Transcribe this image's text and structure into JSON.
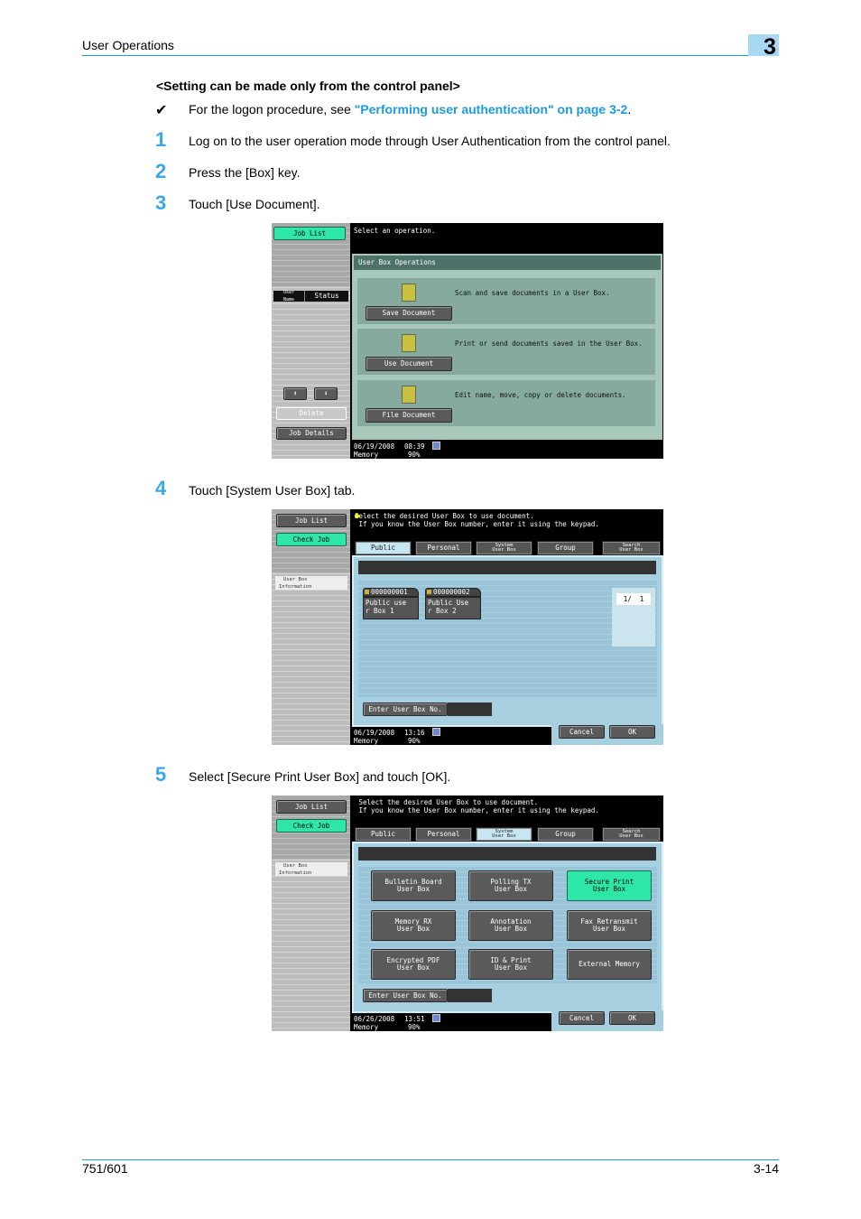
{
  "header": {
    "section": "User Operations",
    "chapter": "3"
  },
  "subheading": "<Setting can be made only from the control panel>",
  "note": {
    "icon": "checkmark-icon",
    "glyph": "✔",
    "prefix": "For the logon procedure, see ",
    "link": "\"Performing user authentication\" on page 3-2",
    "suffix": "."
  },
  "steps": [
    {
      "num": "1",
      "text": "Log on to the user operation mode through User Authentication from the control panel."
    },
    {
      "num": "2",
      "text": "Press the [Box] key."
    },
    {
      "num": "3",
      "text": "Touch [Use Document]."
    },
    {
      "num": "4",
      "text": "Touch [System User Box] tab."
    },
    {
      "num": "5",
      "text": "Select [Secure Print User Box] and touch [OK]."
    }
  ],
  "screen1": {
    "job_list": "Job List",
    "message": "Select an operation.",
    "panel_title": "User Box Operations",
    "col_user": "User\nName",
    "col_status": "Status",
    "up": "⬆",
    "down": "⬇",
    "delete": "Delete",
    "job_details": "Job Details",
    "ops": [
      {
        "button": "Save Document",
        "desc": "Scan and save documents in a User Box.",
        "icon": "save-document-icon"
      },
      {
        "button": "Use Document",
        "desc": "Print or send documents saved in the User Box.",
        "icon": "use-document-icon"
      },
      {
        "button": "File Document",
        "desc": "Edit name, move, copy or delete documents.",
        "icon": "file-document-icon"
      }
    ],
    "date": "06/19/2008",
    "time": "08:39",
    "memory_label": "Memory",
    "memory": "90%"
  },
  "screen2": {
    "job_list": "Job List",
    "check_job": "Check Job",
    "info": "User Box\nInformation",
    "message": "Select the desired User Box to use document.\n If you know the User Box number, enter it using the keypad.",
    "tabs": [
      "Public",
      "Personal",
      "System\nUser Box",
      "Group",
      "Search\nUser Box"
    ],
    "active_tab": 0,
    "boxes": [
      {
        "number": "000000001",
        "name": "Public use\nr Box 1"
      },
      {
        "number": "000000002",
        "name": "Public Use\nr Box 2"
      }
    ],
    "page": "1/  1",
    "enter_no": "Enter User Box No.",
    "cancel": "Cancel",
    "ok": "OK",
    "date": "06/19/2008",
    "time": "13:16",
    "memory_label": "Memory",
    "memory": "90%"
  },
  "screen3": {
    "job_list": "Job List",
    "check_job": "Check Job",
    "info": "User Box\nInformation",
    "message": " Select the desired User Box to use document.\n If you know the User Box number, enter it using the keypad.",
    "tabs": [
      "Public",
      "Personal",
      "System\nUser Box",
      "Group",
      "Search\nUser Box"
    ],
    "active_tab": 2,
    "buttons": [
      "Bulletin Board\nUser Box",
      "Polling TX\nUser Box",
      "Secure Print\nUser Box",
      "Memory RX\nUser Box",
      "Annotation\nUser Box",
      "Fax Retransmit\nUser Box",
      "Encrypted PDF\nUser Box",
      "ID & Print\nUser Box",
      "External Memory"
    ],
    "selected": 2,
    "enter_no": "Enter User Box No.",
    "cancel": "Cancel",
    "ok": "OK",
    "date": "06/26/2008",
    "time": "13:51",
    "memory_label": "Memory",
    "memory": "90%"
  },
  "footer": {
    "model": "751/601",
    "page": "3-14"
  },
  "colors": {
    "accent": "#1e9be0",
    "green_button": "#2ee6a8",
    "panel_teal": "#86aa9e",
    "panel_blue": "#a6cfe0"
  }
}
